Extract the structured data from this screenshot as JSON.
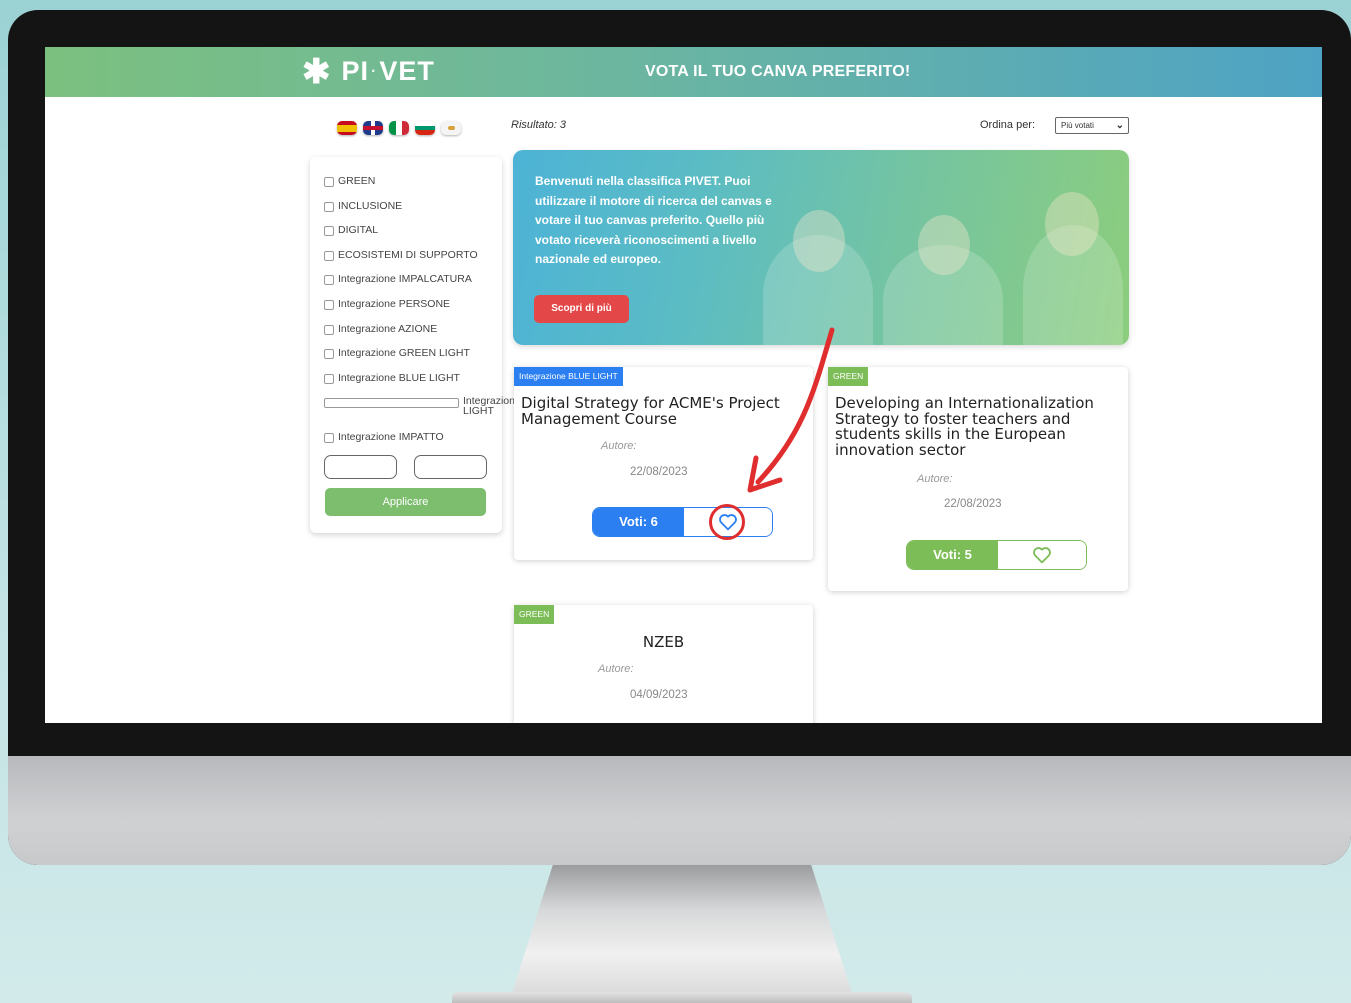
{
  "header": {
    "logo_text_left": "PI",
    "logo_text_right": "VET",
    "banner_title": "VOTA IL TUO CANVA PREFERITO!"
  },
  "languages": [
    "es",
    "en",
    "it",
    "bg",
    "cy"
  ],
  "filters": {
    "items": [
      "GREEN",
      "INCLUSIONE",
      "DIGITAL",
      "ECOSISTEMI DI SUPPORTO",
      "Integrazione IMPALCATURA",
      "Integrazione PERSONE",
      "Integrazione AZIONE",
      "Integrazione GREEN LIGHT",
      "Integrazione BLUE LIGHT",
      "Integrazione INCLUSION LIGHT",
      "Integrazione IMPATTO"
    ],
    "apply_label": "Applicare"
  },
  "results": {
    "count_label": "Risultato: 3",
    "sort_label": "Ordina per:",
    "sort_value": "Più votati"
  },
  "hero": {
    "text": "Benvenuti nella classifica PIVET. Puoi utilizzare il motore di ricerca del canvas e votare il tuo canvas preferito. Quello più votato riceverà riconoscimenti a livello nazionale ed europeo.",
    "button_label": "Scopri di più"
  },
  "cards": [
    {
      "tag": "Integrazione BLUE LIGHT",
      "title": "Digital Strategy for ACME's Project Management Course",
      "author_label": "Autore:",
      "date": "22/08/2023",
      "votes_label": "Voti: 6"
    },
    {
      "tag": "GREEN",
      "title": "Developing an Internationalization Strategy to foster teachers and students skills in the European innovation sector",
      "author_label": "Autore:",
      "date": "22/08/2023",
      "votes_label": "Voti: 5"
    },
    {
      "tag": "GREEN",
      "title": "NZEB",
      "author_label": "Autore:",
      "date": "04/09/2023"
    }
  ],
  "colors": {
    "accent_blue": "#2c7ff0",
    "accent_green": "#7dbd58",
    "cta_red": "#e44747",
    "annotation_red": "#e02d2d"
  }
}
